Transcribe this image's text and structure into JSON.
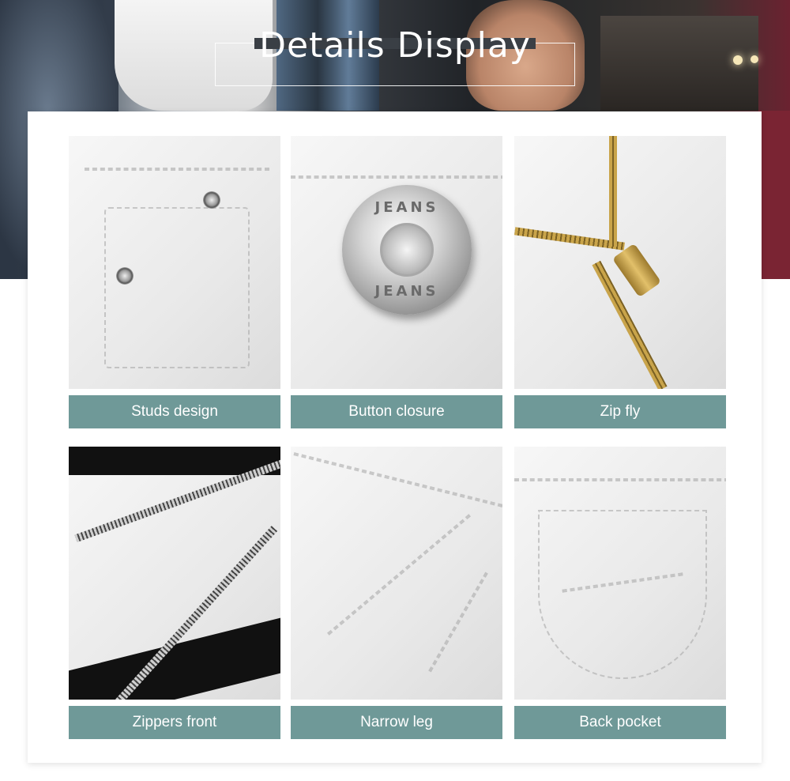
{
  "header": {
    "title": "Details Display"
  },
  "details": [
    {
      "caption": "Studs design",
      "icon": "studs-photo"
    },
    {
      "caption": "Button closure",
      "icon": "button-photo",
      "button_text_top": "JEANS",
      "button_text_bottom": "JEANS"
    },
    {
      "caption": "Zip fly",
      "icon": "zip-fly-photo"
    },
    {
      "caption": "Zippers front",
      "icon": "zippers-front-photo"
    },
    {
      "caption": "Narrow leg",
      "icon": "narrow-leg-photo"
    },
    {
      "caption": "Back pocket",
      "icon": "back-pocket-photo"
    }
  ],
  "colors": {
    "caption_bg": "#6f9998",
    "caption_text": "#ffffff",
    "panel_bg": "#ffffff"
  }
}
